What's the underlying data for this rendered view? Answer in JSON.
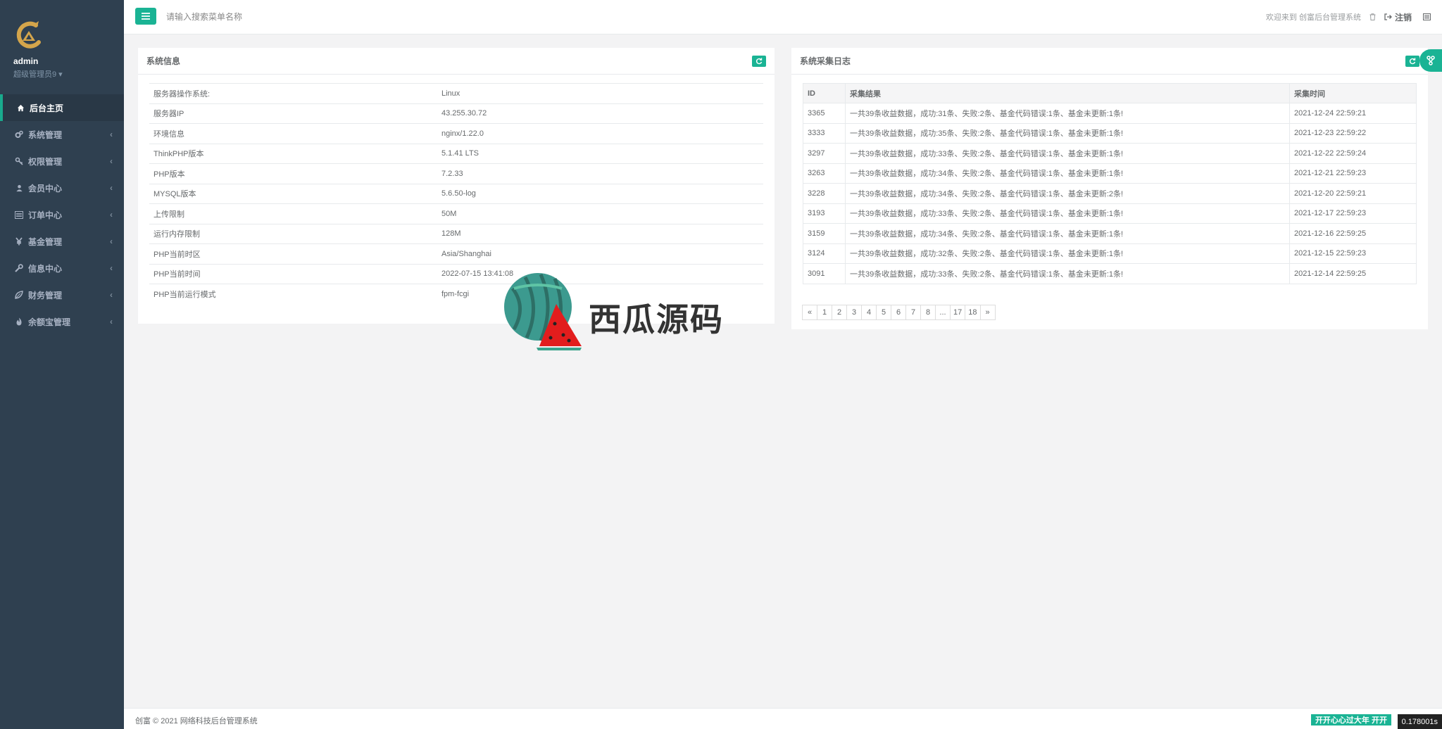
{
  "sidebar": {
    "profile_name": "admin",
    "profile_role": "超级管理员9 ▾",
    "items": [
      {
        "label": "后台主页",
        "icon": "home-icon",
        "active": true
      },
      {
        "label": "系统管理",
        "icon": "cogs-icon"
      },
      {
        "label": "权限管理",
        "icon": "key-icon"
      },
      {
        "label": "会员中心",
        "icon": "user-icon"
      },
      {
        "label": "订单中心",
        "icon": "list-alt-icon"
      },
      {
        "label": "基金管理",
        "icon": "yen-icon"
      },
      {
        "label": "信息中心",
        "icon": "wrench-icon"
      },
      {
        "label": "财务管理",
        "icon": "leaf-icon"
      },
      {
        "label": "余额宝管理",
        "icon": "fire-icon"
      }
    ],
    "arrow": "‹"
  },
  "topbar": {
    "search_placeholder": "请输入搜索菜单名称",
    "welcome": "欢迎来到 创富后台管理系统",
    "logout_label": "注销"
  },
  "system_info": {
    "title": "系统信息",
    "rows": [
      {
        "label": "服务器操作系统:",
        "value": "Linux"
      },
      {
        "label": "服务器IP",
        "value": "43.255.30.72"
      },
      {
        "label": "环境信息",
        "value": "nginx/1.22.0"
      },
      {
        "label": "ThinkPHP版本",
        "value": "5.1.41 LTS"
      },
      {
        "label": "PHP版本",
        "value": "7.2.33"
      },
      {
        "label": "MYSQL版本",
        "value": "5.6.50-log"
      },
      {
        "label": "上传限制",
        "value": "50M"
      },
      {
        "label": "运行内存限制",
        "value": "128M"
      },
      {
        "label": "PHP当前时区",
        "value": "Asia/Shanghai"
      },
      {
        "label": "PHP当前时间",
        "value": "2022-07-15 13:41:08"
      },
      {
        "label": "PHP当前运行模式",
        "value": "fpm-fcgi"
      }
    ]
  },
  "collect_log": {
    "title": "系统采集日志",
    "columns": [
      "ID",
      "采集结果",
      "采集时间"
    ],
    "rows": [
      {
        "id": "3365",
        "result": "一共39条收益数据，成功:31条、失败:2条、基金代码错误:1条、基金未更新:1条!",
        "time": "2021-12-24 22:59:21"
      },
      {
        "id": "3333",
        "result": "一共39条收益数据，成功:35条、失败:2条、基金代码错误:1条、基金未更新:1条!",
        "time": "2021-12-23 22:59:22"
      },
      {
        "id": "3297",
        "result": "一共39条收益数据，成功:33条、失败:2条、基金代码错误:1条、基金未更新:1条!",
        "time": "2021-12-22 22:59:24"
      },
      {
        "id": "3263",
        "result": "一共39条收益数据，成功:34条、失败:2条、基金代码错误:1条、基金未更新:1条!",
        "time": "2021-12-21 22:59:23"
      },
      {
        "id": "3228",
        "result": "一共39条收益数据，成功:34条、失败:2条、基金代码错误:1条、基金未更新:2条!",
        "time": "2021-12-20 22:59:21"
      },
      {
        "id": "3193",
        "result": "一共39条收益数据，成功:33条、失败:2条、基金代码错误:1条、基金未更新:1条!",
        "time": "2021-12-17 22:59:23"
      },
      {
        "id": "3159",
        "result": "一共39条收益数据，成功:34条、失败:2条、基金代码错误:1条、基金未更新:1条!",
        "time": "2021-12-16 22:59:25"
      },
      {
        "id": "3124",
        "result": "一共39条收益数据，成功:32条、失败:2条、基金代码错误:1条、基金未更新:1条!",
        "time": "2021-12-15 22:59:23"
      },
      {
        "id": "3091",
        "result": "一共39条收益数据，成功:33条、失败:2条、基金代码错误:1条、基金未更新:1条!",
        "time": "2021-12-14 22:59:25"
      }
    ],
    "pages": [
      "«",
      "1",
      "2",
      "3",
      "4",
      "5",
      "6",
      "7",
      "8",
      "...",
      "17",
      "18",
      "»"
    ]
  },
  "watermark": {
    "text": "西瓜源码"
  },
  "footer": {
    "copyright": "创富 © 2021 网络科技后台管理系统",
    "marquee": "开开心心过大年 开开",
    "timer": "0.178001s"
  },
  "colors": {
    "accent": "#1ab394",
    "sidebar_bg": "#2f4050"
  }
}
